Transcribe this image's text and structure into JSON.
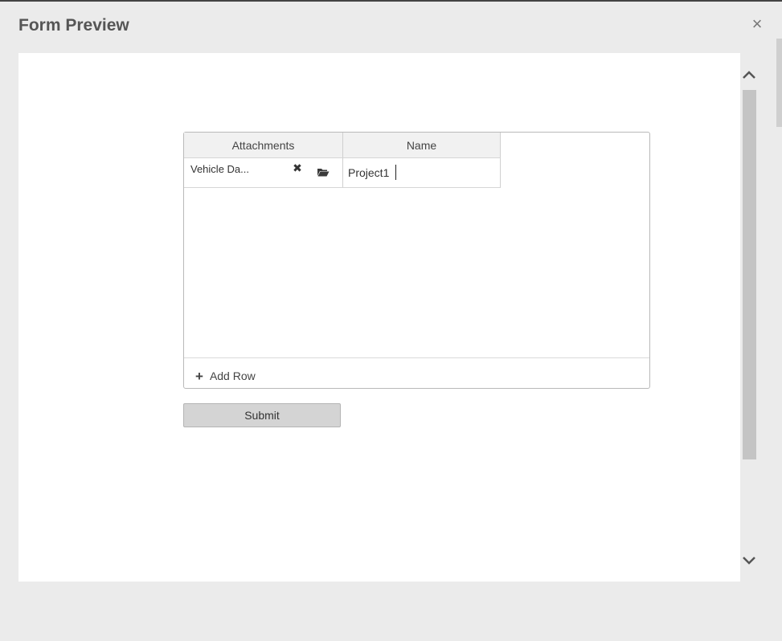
{
  "dialog": {
    "title": "Form Preview",
    "close_icon": "close-icon",
    "close_glyph": "×"
  },
  "grid": {
    "columns": [
      "Attachments",
      "Name"
    ],
    "rows": [
      {
        "attachment": "Vehicle Da...",
        "remove_icon": "remove-icon",
        "remove_glyph": "✖",
        "browse_icon": "folder-open-icon",
        "name": "Project1"
      }
    ],
    "add_row_icon": "plus-icon",
    "add_row_glyph": "+",
    "add_row_label": "Add Row"
  },
  "submit_label": "Submit",
  "scrollbar": {
    "up_icon": "chevron-up-icon",
    "down_icon": "chevron-down-icon"
  },
  "colors": {
    "dialog_background": "#ebebeb",
    "content_background": "#ffffff",
    "header_background": "#f1f1f1",
    "button_background": "#d4d4d4",
    "scrollbar_thumb": "#c4c4c4"
  }
}
